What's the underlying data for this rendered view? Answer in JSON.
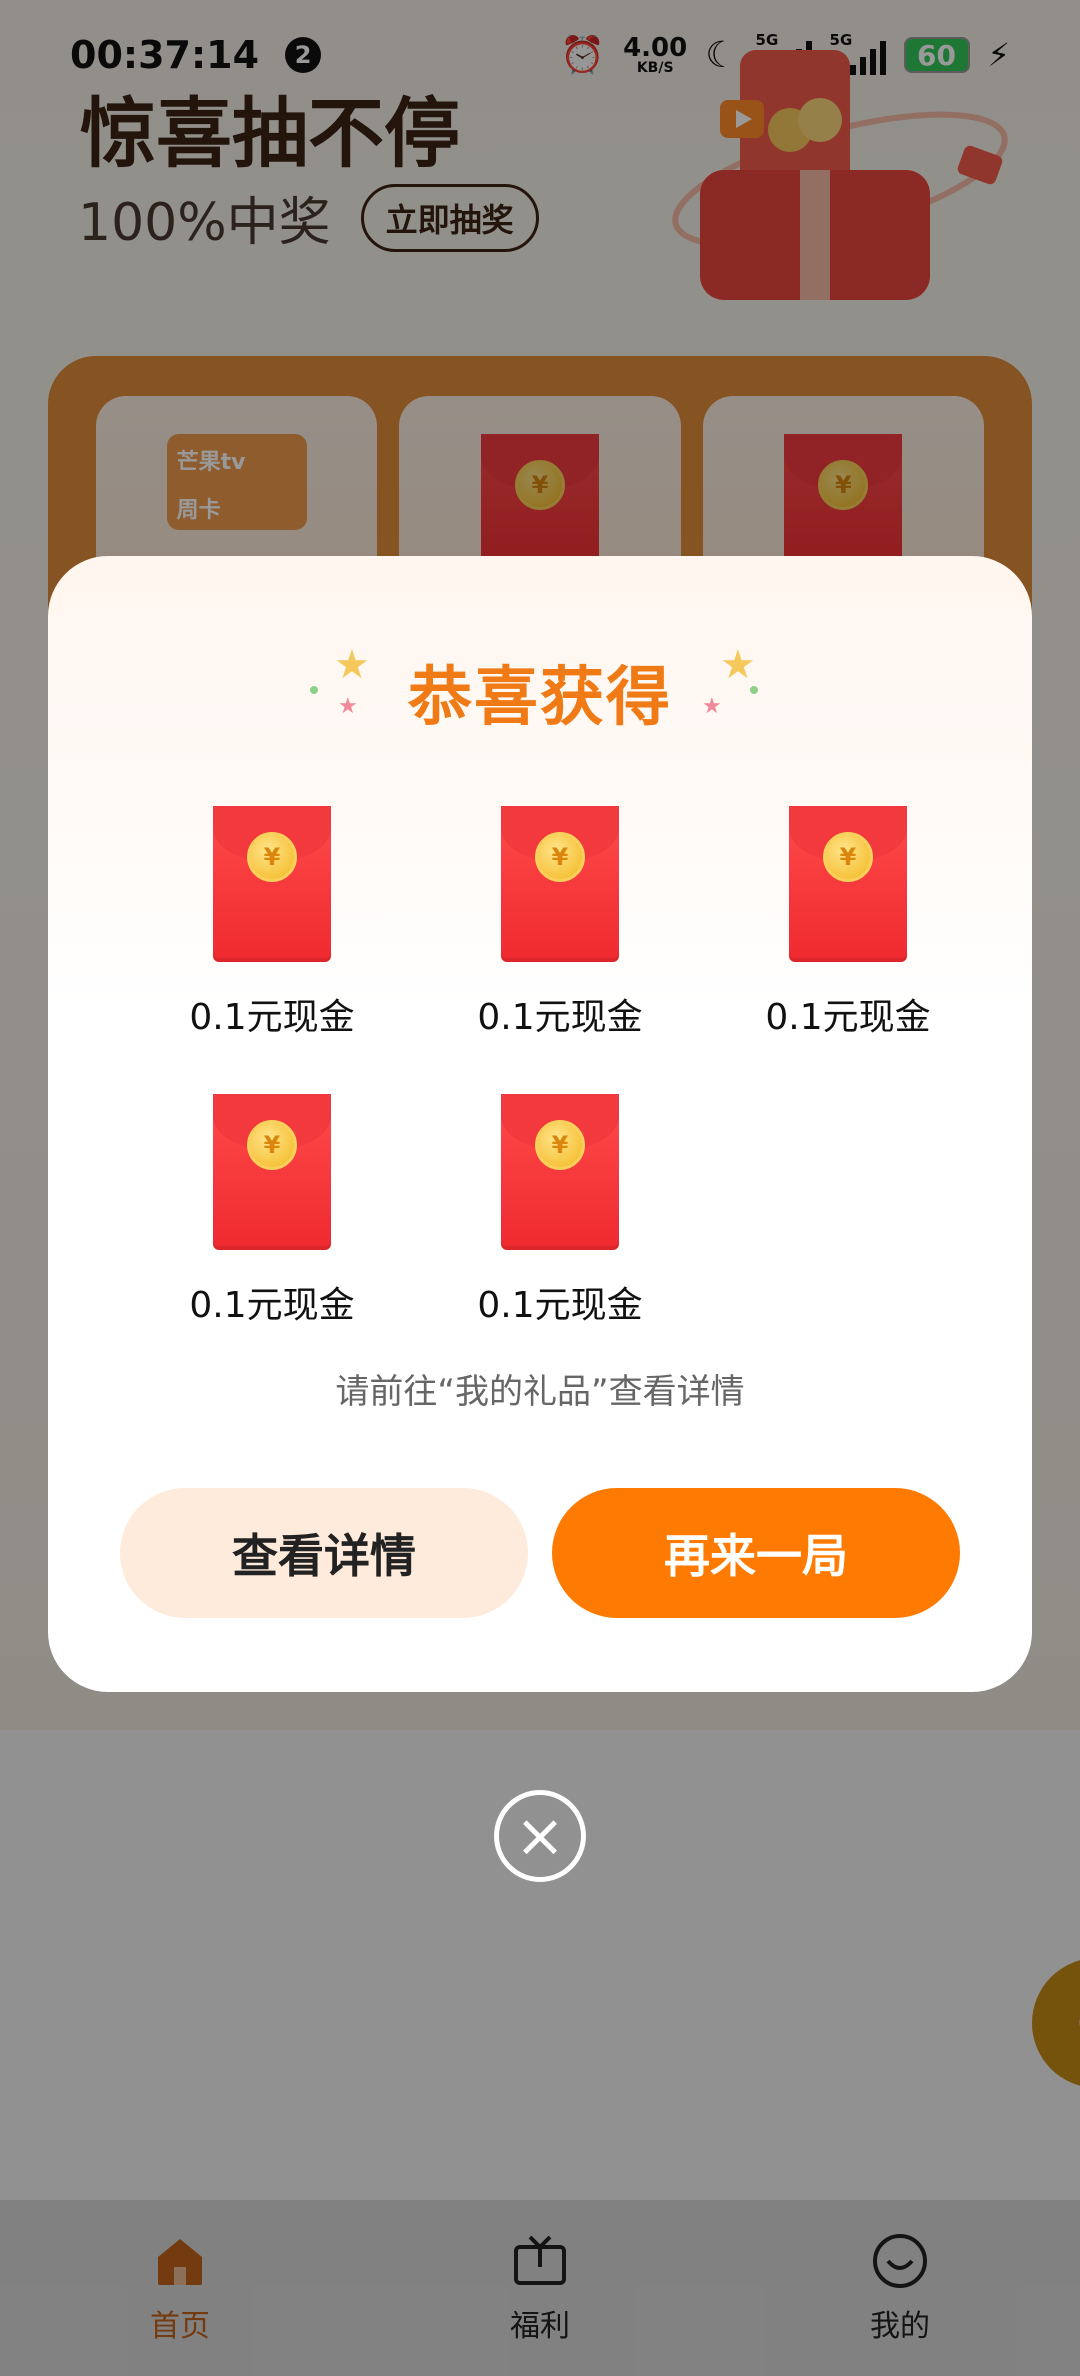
{
  "status_bar": {
    "time": "00:37:14",
    "notification_count": "2",
    "net_speed_value": "4.00",
    "net_speed_unit": "KB/S",
    "signal_1_tag": "5G",
    "signal_2_tag": "5G",
    "battery": "60"
  },
  "hero": {
    "title": "惊喜抽不停",
    "rate_text": "100%中奖",
    "draw_button": "立即抽奖"
  },
  "board": {
    "card_brand": "芒果tv",
    "card_type": "周卡"
  },
  "modal": {
    "title": "恭喜获得",
    "prizes": [
      {
        "label": "0.1元现金"
      },
      {
        "label": "0.1元现金"
      },
      {
        "label": "0.1元现金"
      },
      {
        "label": "0.1元现金"
      },
      {
        "label": "0.1元现金"
      }
    ],
    "note": "请前往“我的礼品”查看详情",
    "details_button": "查看详情",
    "again_button": "再来一局",
    "coin_symbol": "¥"
  },
  "close_icon": "×",
  "bottom_nav": {
    "items": [
      {
        "label": "首页",
        "icon": "home-icon",
        "active": true
      },
      {
        "label": "福利",
        "icon": "tv-icon",
        "active": false
      },
      {
        "label": "我的",
        "icon": "smile-icon",
        "active": false
      }
    ]
  },
  "colors": {
    "accent": "#ff7a00",
    "title_orange": "#f07a16",
    "redpack": "#ef2a2e",
    "nav_active": "#c2621c"
  }
}
